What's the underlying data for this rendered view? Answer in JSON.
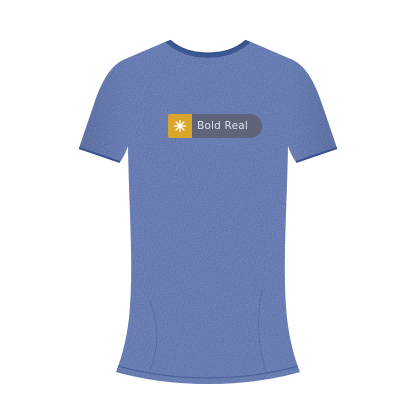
{
  "product": {
    "garment": "t-shirt",
    "garment_color": "#4a66a7",
    "print": {
      "text": "Bold Real",
      "icon": "sun-burst-icon",
      "badge_color": "#d9a62b",
      "pill_color": "#5f6478",
      "text_color": "#dfe2ea"
    }
  }
}
